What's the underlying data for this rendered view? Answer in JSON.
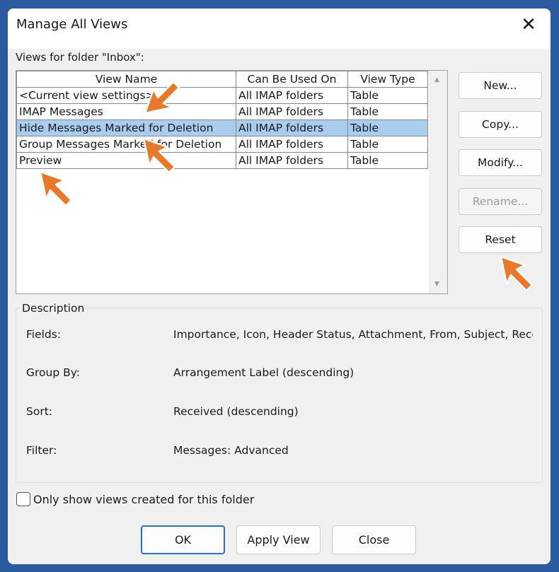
{
  "dialog": {
    "title": "Manage All Views",
    "close_icon": "close-icon"
  },
  "views_label": "Views for folder \"Inbox\":",
  "table": {
    "columns": [
      "View Name",
      "Can Be Used On",
      "View Type"
    ],
    "rows": [
      [
        "<Current view settings>",
        "All IMAP folders",
        "Table"
      ],
      [
        "IMAP Messages",
        "All IMAP folders",
        "Table"
      ],
      [
        "Hide Messages Marked for Deletion",
        "All IMAP folders",
        "Table"
      ],
      [
        "Group Messages Marked for Deletion",
        "All IMAP folders",
        "Table"
      ],
      [
        "Preview",
        "All IMAP folders",
        "Table"
      ]
    ],
    "selected_row": 2
  },
  "side_buttons": {
    "new": "New...",
    "copy": "Copy...",
    "modify": "Modify...",
    "rename": "Rename...",
    "reset": "Reset"
  },
  "description": {
    "title": "Description",
    "fields_label": "Fields:",
    "fields_value": "Importance, Icon, Header Status, Attachment, From, Subject, Receive",
    "group_label": "Group By:",
    "group_value": "Arrangement Label (descending)",
    "sort_label": "Sort:",
    "sort_value": "Received (descending)",
    "filter_label": "Filter:",
    "filter_value": "Messages: Advanced"
  },
  "checkbox": {
    "label": "Only show views created for this folder",
    "checked": false
  },
  "footer": {
    "ok": "OK",
    "apply": "Apply View",
    "close": "Close"
  },
  "colors": {
    "selection": "#a9cdee",
    "arrow": "#e8782a",
    "background": "#2c5a9e"
  }
}
